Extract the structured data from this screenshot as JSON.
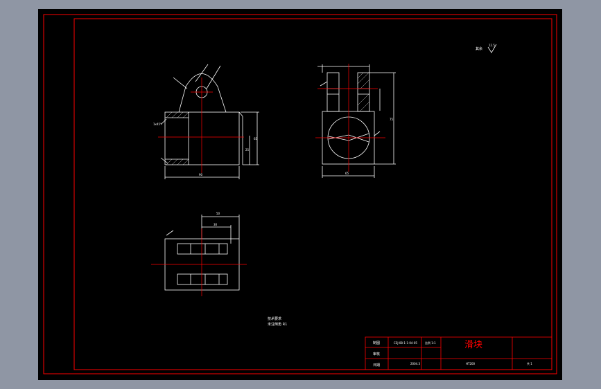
{
  "colors": {
    "background": "#8f96a4",
    "sheet": "#000000",
    "border": "#ff0000",
    "outline": "#ffffff",
    "centerline": "#ff0000",
    "text": "#ffffff"
  },
  "roughness_note": {
    "label": "其余",
    "symbol": "12.5"
  },
  "notes": {
    "line1": "技术要求",
    "line2": "未注倒角 R1"
  },
  "title_block": {
    "label_design": "制图",
    "label_check": "审核",
    "label_date": "日期",
    "drawing_no": "CSJ-08-1-1-04-05",
    "scale_label": "比例 1:1",
    "part_name": "滑块",
    "material": "HT200",
    "school": "2004.3",
    "sheet": "共 1"
  },
  "dimensions": {
    "front_width": "90",
    "front_height": "65",
    "front_inner": "25",
    "chamfer": "1x45°",
    "side_width": "65",
    "side_height": "75",
    "top_width": "50",
    "top_inner": "30"
  }
}
